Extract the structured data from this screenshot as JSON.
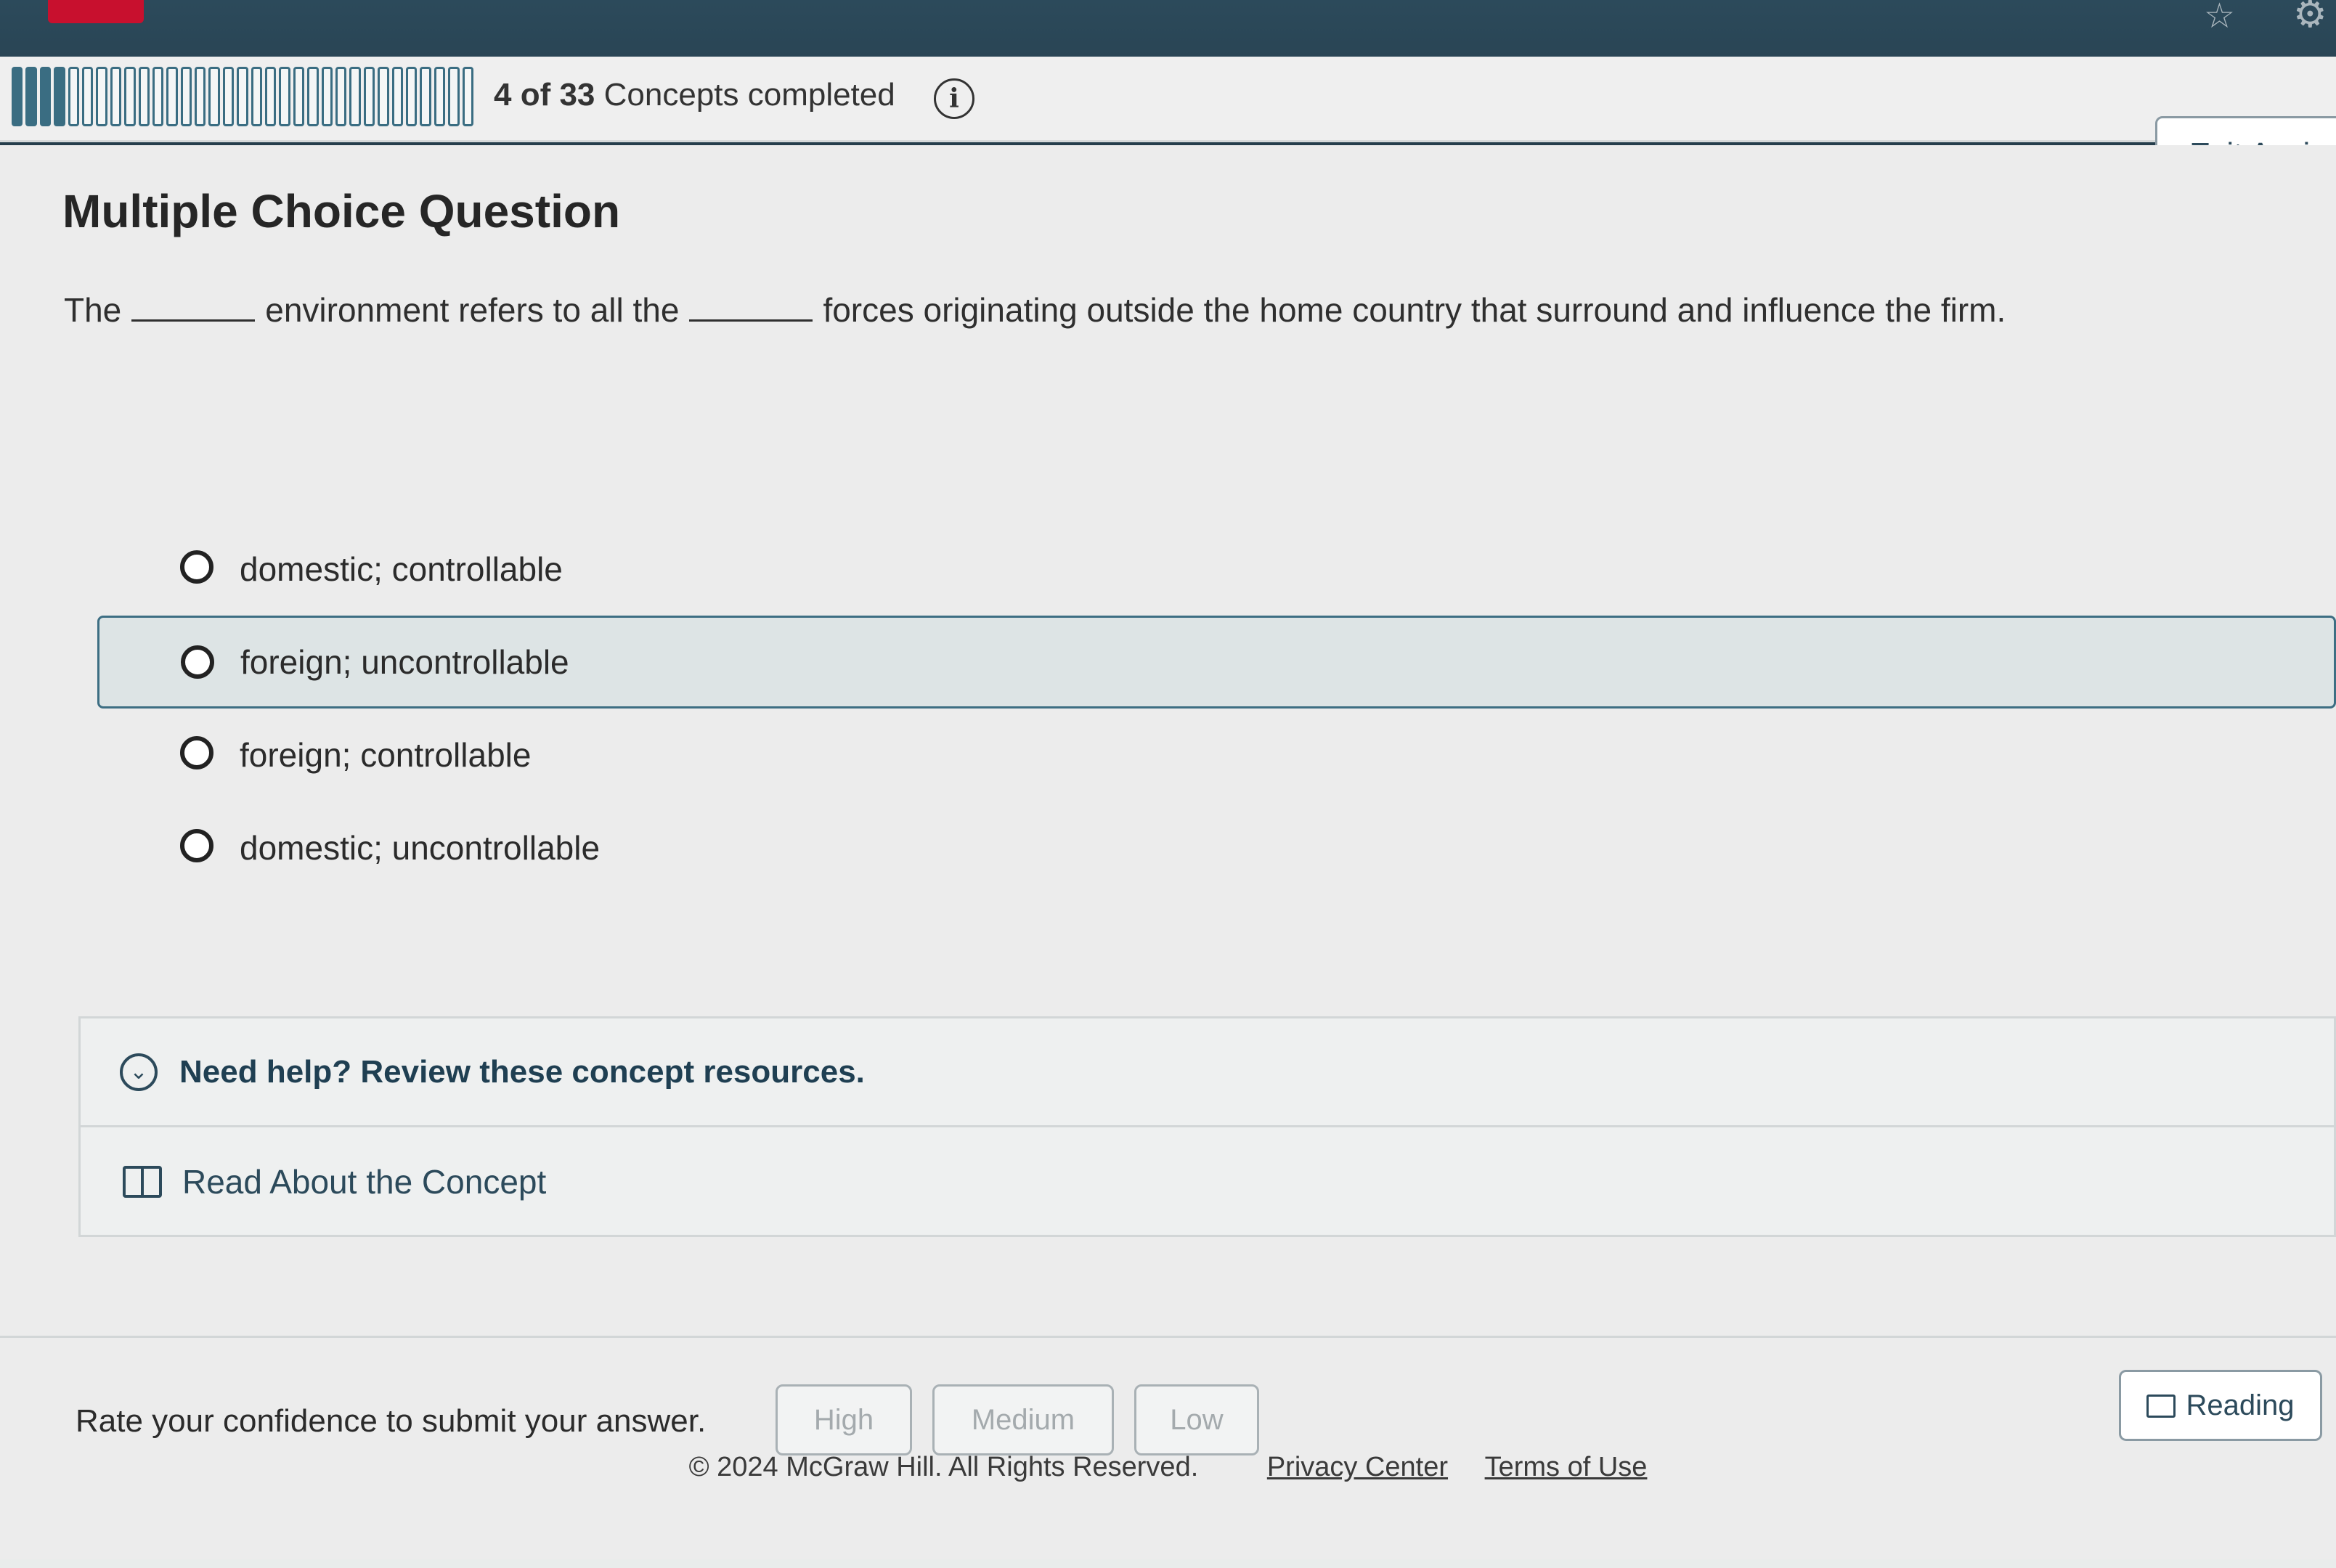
{
  "header": {
    "progress": {
      "completed": 4,
      "total": 33,
      "count_text": "4 of 33",
      "suffix": "Concepts completed"
    },
    "info_icon": "i",
    "exit_label": "Exit Assign",
    "icons": [
      "star-icon",
      "gear-icon"
    ]
  },
  "question": {
    "heading": "Multiple Choice Question",
    "text_parts": [
      "The",
      "environment refers to all the",
      "forces originating outside the home country that surround and influence the firm."
    ]
  },
  "options": [
    {
      "label": "domestic; controllable"
    },
    {
      "label": "foreign; uncontrollable",
      "hover": true
    },
    {
      "label": "foreign; controllable"
    },
    {
      "label": "domestic; uncontrollable"
    }
  ],
  "help": {
    "title": "Need help? Review these concept resources.",
    "link_label": "Read About the Concept"
  },
  "confidence": {
    "prompt": "Rate your confidence to submit your answer.",
    "high": "High",
    "medium": "Medium",
    "low": "Low",
    "reading_label": "Reading"
  },
  "footer": {
    "copyright": "© 2024 McGraw Hill. All Rights Reserved.",
    "privacy": "Privacy Center",
    "terms": "Terms of Use"
  },
  "colors": {
    "header_bg": "#2c4a5b",
    "accent": "#3a6d82",
    "brand_red": "#c8102e"
  }
}
